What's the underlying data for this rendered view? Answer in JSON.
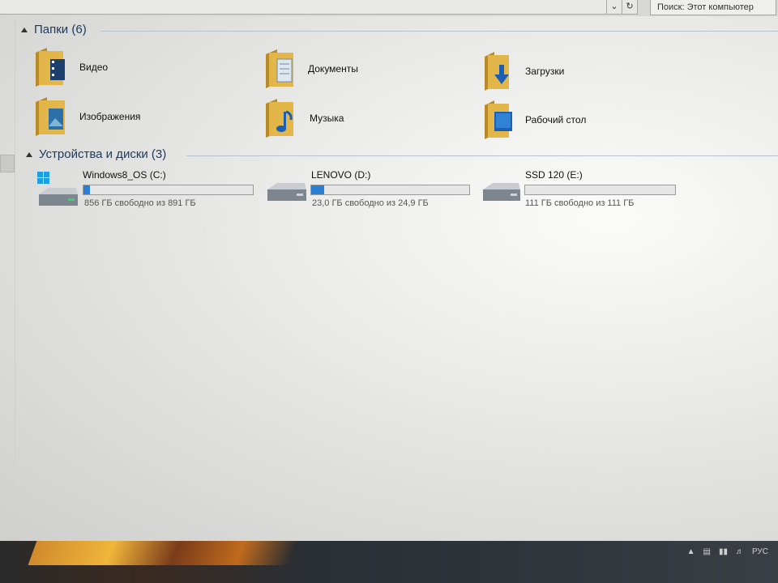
{
  "toolbar": {
    "dropdown_icon": "chevron-down-icon",
    "refresh_icon": "refresh-icon",
    "search_placeholder": "Поиск: Этот компьютер"
  },
  "folders": {
    "header": "Папки (6)",
    "items": [
      {
        "label": "Видео",
        "icon": "video-folder-icon"
      },
      {
        "label": "Документы",
        "icon": "documents-folder-icon"
      },
      {
        "label": "Загрузки",
        "icon": "downloads-folder-icon"
      },
      {
        "label": "Изображения",
        "icon": "pictures-folder-icon"
      },
      {
        "label": "Музыка",
        "icon": "music-folder-icon"
      },
      {
        "label": "Рабочий стол",
        "icon": "desktop-folder-icon"
      }
    ]
  },
  "devices": {
    "header": "Устройства и диски (3)",
    "drives": [
      {
        "name": "Windows8_OS (C:)",
        "free_text": "856 ГБ свободно из 891 ГБ",
        "used_fraction": 0.04,
        "icon": "system-drive-icon"
      },
      {
        "name": "LENOVO (D:)",
        "free_text": "23,0 ГБ свободно из 24,9 ГБ",
        "used_fraction": 0.08,
        "icon": "hard-drive-icon"
      },
      {
        "name": "SSD 120 (E:)",
        "free_text": "111 ГБ свободно из 111 ГБ",
        "used_fraction": 0.0,
        "icon": "hard-drive-icon"
      }
    ]
  },
  "tray": {
    "language": "РУС"
  },
  "colors": {
    "accent": "#2a7fd4",
    "folder": "#e3b64a",
    "group_header": "#1e395b"
  }
}
